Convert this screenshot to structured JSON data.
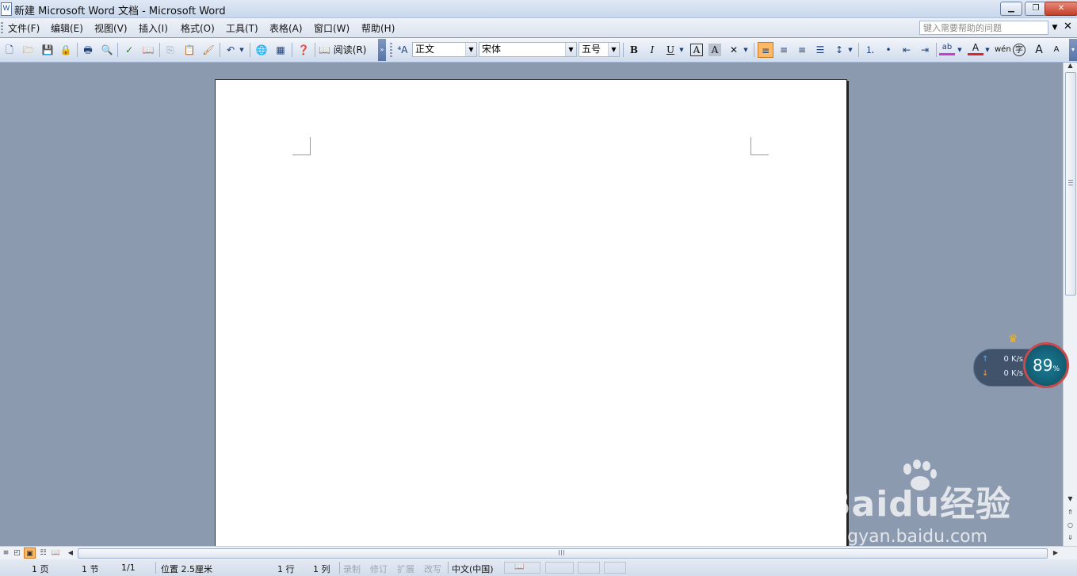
{
  "window": {
    "title": "新建 Microsoft Word 文档 - Microsoft Word",
    "minimize_glyph": "▁",
    "restore_glyph": "❐",
    "close_glyph": "✕"
  },
  "menu": {
    "items": [
      "文件(F)",
      "编辑(E)",
      "视图(V)",
      "插入(I)",
      "格式(O)",
      "工具(T)",
      "表格(A)",
      "窗口(W)",
      "帮助(H)"
    ],
    "help_placeholder": "键入需要帮助的问题",
    "doc_close_glyph": "✕"
  },
  "toolbar": {
    "read_label": "阅读(R)",
    "style_value": "正文",
    "font_value": "宋体",
    "size_value": "五号",
    "bold": "B",
    "italic": "I",
    "underline": "U",
    "char_border": "A",
    "char_shade": "A",
    "phonetic": "wén",
    "enclose": "字",
    "grow_font": "A",
    "shrink_font": "A",
    "align_left_active": true
  },
  "icons": {
    "new": "new-doc-icon",
    "open": "open-folder-icon",
    "save": "save-icon",
    "permission": "permission-icon",
    "print": "print-icon",
    "preview": "print-preview-icon",
    "spell": "spell-check-icon",
    "research": "research-icon",
    "copy": "copy-icon",
    "paste": "paste-icon",
    "format_painter": "format-painter-icon",
    "undo": "undo-icon",
    "hyperlink": "hyperlink-icon",
    "table": "table-icon",
    "help": "help-icon",
    "styles_pane": "styles-pane-icon"
  },
  "network_widget": {
    "upload": "0 K/s",
    "download": "0 K/s",
    "percent": "89",
    "percent_unit": "%"
  },
  "watermark": {
    "brand": "Baidu经验",
    "site": "jingyan.baidu.com"
  },
  "statusbar": {
    "page": "1 页",
    "section": "1 节",
    "page_of": "1/1",
    "position": "位置 2.5厘米",
    "line": "1 行",
    "column": "1 列",
    "rec": "录制",
    "trk": "修订",
    "ext": "扩展",
    "ovr": "改写",
    "language": "中文(中国)"
  },
  "colors": {
    "accent_active": "#ffb864",
    "doc_background": "#8c9ab0",
    "highlight_bar": "#d23ad6",
    "font_color_bar": "#e0232b"
  }
}
